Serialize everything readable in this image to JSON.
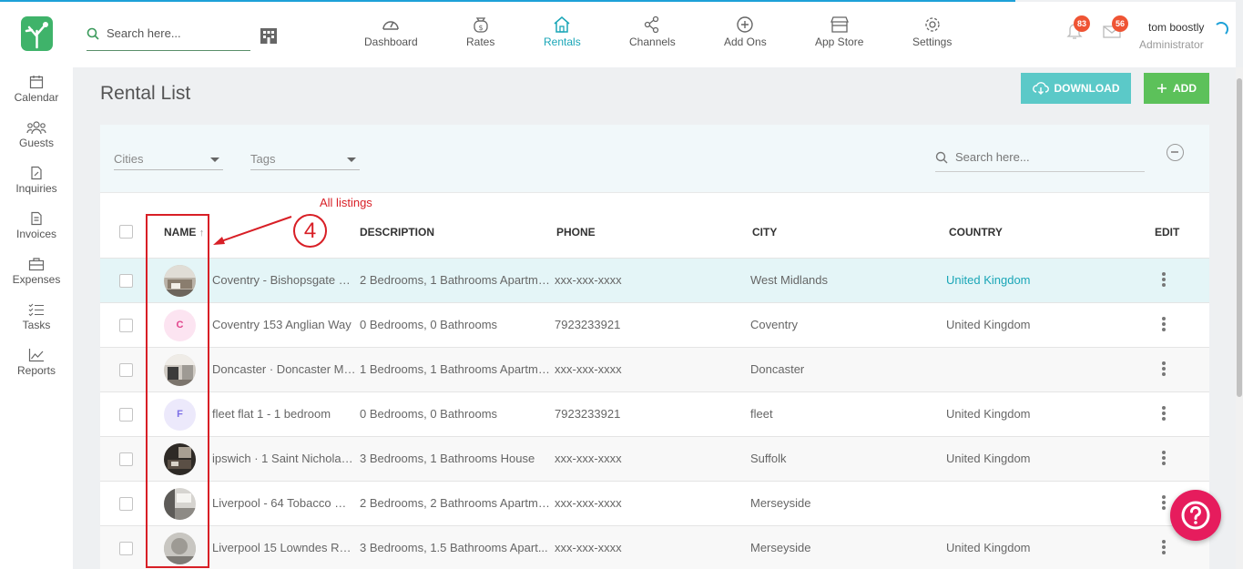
{
  "header": {
    "search_placeholder": "Search here...",
    "nav": [
      {
        "label": "Dashboard",
        "icon": "gauge-icon"
      },
      {
        "label": "Rates",
        "icon": "money-bag-icon"
      },
      {
        "label": "Rentals",
        "icon": "home-icon",
        "active": true
      },
      {
        "label": "Channels",
        "icon": "share-icon"
      },
      {
        "label": "Add Ons",
        "icon": "plus-circle-icon"
      },
      {
        "label": "App Store",
        "icon": "store-icon"
      },
      {
        "label": "Settings",
        "icon": "gear-icon"
      }
    ],
    "notifications_count": "83",
    "messages_count": "56",
    "user_name": "tom boostly",
    "user_role": "Administrator"
  },
  "sidebar": {
    "items": [
      {
        "label": "Calendar",
        "icon": "calendar-icon"
      },
      {
        "label": "Guests",
        "icon": "users-icon"
      },
      {
        "label": "Inquiries",
        "icon": "inquiry-icon"
      },
      {
        "label": "Invoices",
        "icon": "invoice-icon"
      },
      {
        "label": "Expenses",
        "icon": "briefcase-icon"
      },
      {
        "label": "Tasks",
        "icon": "checklist-icon"
      },
      {
        "label": "Reports",
        "icon": "chart-icon"
      }
    ]
  },
  "main": {
    "title": "Rental List",
    "download_label": "DOWNLOAD",
    "add_label": "ADD",
    "filters": {
      "cities": "Cities",
      "tags": "Tags",
      "search_placeholder": "Search here..."
    },
    "columns": {
      "name": "NAME",
      "description": "DESCRIPTION",
      "phone": "PHONE",
      "city": "CITY",
      "country": "COUNTRY",
      "edit": "EDIT"
    },
    "rows": [
      {
        "avatar": "photo",
        "name": "Coventry - Bishopsgate H...",
        "description": "2 Bedrooms, 1 Bathrooms Apartment",
        "phone": "xxx-xxx-xxxx",
        "city": "West Midlands",
        "country": "United Kingdom"
      },
      {
        "avatar": "C",
        "name": "Coventry 153 Anglian Way",
        "description": "0 Bedrooms, 0 Bathrooms",
        "phone": "7923233921",
        "city": "Coventry",
        "country": "United Kingdom"
      },
      {
        "avatar": "photo",
        "name": "Doncaster · Doncaster Ma...",
        "description": "1 Bedrooms, 1 Bathrooms Apartment",
        "phone": "xxx-xxx-xxxx",
        "city": "Doncaster",
        "country": ""
      },
      {
        "avatar": "F",
        "name": "fleet flat 1 - 1 bedroom",
        "description": "0 Bedrooms, 0 Bathrooms",
        "phone": "7923233921",
        "city": "fleet",
        "country": "United Kingdom"
      },
      {
        "avatar": "photo",
        "name": "ipswich · 1 Saint Nicholas ...",
        "description": "3 Bedrooms, 1 Bathrooms House",
        "phone": "xxx-xxx-xxxx",
        "city": "Suffolk",
        "country": "United Kingdom"
      },
      {
        "avatar": "photo",
        "name": "Liverpool - 64 Tobacco Wh...",
        "description": "2 Bedrooms, 2 Bathrooms Apartment",
        "phone": "xxx-xxx-xxxx",
        "city": "Merseyside",
        "country": ""
      },
      {
        "avatar": "photo",
        "name": "Liverpool 15 Lowndes Road",
        "description": "3 Bedrooms, 1.5 Bathrooms Apart...",
        "phone": "xxx-xxx-xxxx",
        "city": "Merseyside",
        "country": "United Kingdom"
      }
    ]
  },
  "annotation": {
    "label": "All listings",
    "step": "4"
  },
  "colors": {
    "accent": "#1aa6b7",
    "download": "#5bc9c8",
    "add": "#5cc15a",
    "annotation": "#d81f26",
    "help": "#e61c5d"
  }
}
